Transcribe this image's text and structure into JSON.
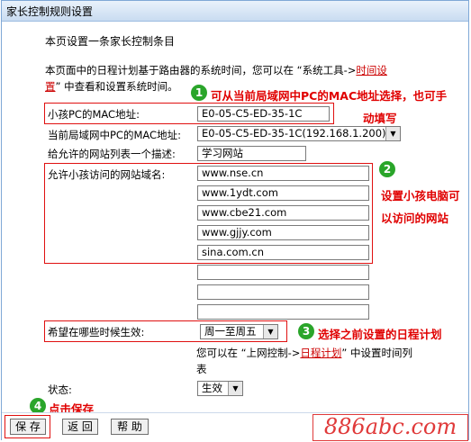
{
  "title": "家长控制规则设置",
  "intro": "本页设置一条家长控制条目",
  "desc": {
    "line1_prefix": "本页面中的日程计划基于路由器的系统时间，您可以在 “系统工具->",
    "line1_link": "时间设",
    "line2_link": "置",
    "line2_suffix": "” 中查看和设置系统时间。"
  },
  "fields": {
    "child_mac_label": "小孩PC的MAC地址:",
    "child_mac_value": "E0-05-C5-ED-35-1C",
    "current_mac_label": "当前局域网中PC的MAC地址:",
    "current_mac_value": "E0-05-C5-ED-35-1C(192.168.1.200)",
    "site_list_desc_label": "给允许的网站列表一个描述:",
    "site_list_desc_value": "学习网站",
    "domains_label": "允许小孩访问的网站域名:",
    "domains": [
      "www.nse.cn",
      "www.1ydt.com",
      "www.cbe21.com",
      "www.gjjy.com",
      "sina.com.cn",
      "",
      "",
      ""
    ],
    "schedule_label": "希望在哪些时候生效:",
    "schedule_value": "周一至周五",
    "schedule_hint_prefix": "您可以在 “上网控制->",
    "schedule_hint_link": "日程计划",
    "schedule_hint_suffix": "” 中设置时间列",
    "schedule_hint_line2": "表",
    "status_label": "状态:",
    "status_value": "生效"
  },
  "annotations": {
    "n1": "1",
    "a1_line1": "可从当前局域网中PC的MAC地址选择，也可手",
    "a1_line2": "动填写",
    "n2": "2",
    "a2_line1": "设置小孩电脑可",
    "a2_line2": "以访问的网站",
    "n3": "3",
    "a3": "选择之前设置的日程计划",
    "n4": "4",
    "a4": "点击保存"
  },
  "buttons": {
    "save": "保 存",
    "back": "返 回",
    "help": "帮 助"
  },
  "watermark": "886abc.com",
  "colors": {
    "annotation": "#e00000",
    "badge": "#2aa52a",
    "link": "#cc0000"
  }
}
